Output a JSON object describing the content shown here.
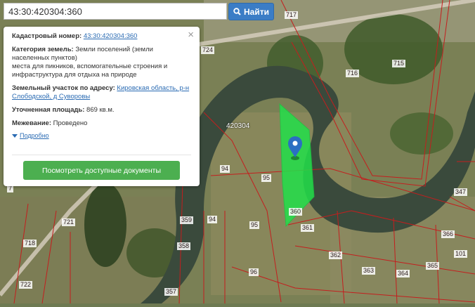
{
  "search": {
    "value": "43:30:420304:360",
    "button_label": "Найти"
  },
  "popup": {
    "cadastral_label": "Кадастровый номер:",
    "cadastral_value": "43:30:420304:360",
    "category_label": "Категория земель:",
    "category_value": "Земли поселений (земли населенных пунктов)",
    "purpose_text": "места для пикников, вспомогательные строения и инфраструктура для отдыха на природе",
    "address_label": "Земельный участок по адресу:",
    "address_value": "Кировская область, р-н Слободской, д Суворовы",
    "area_label": "Уточненная площадь:",
    "area_value": "869 кв.м.",
    "survey_label": "Межевание:",
    "survey_value": "Проведено",
    "more_label": "Подробно",
    "docs_button": "Посмотреть доступные документы",
    "close_symbol": "×"
  },
  "map": {
    "block_label": "420304",
    "parcel_labels": [
      "717",
      "715",
      "716",
      "724",
      "94",
      "95",
      "95",
      "359",
      "94",
      "358",
      "361",
      "362",
      "363",
      "364",
      "365",
      "366",
      "347",
      "101",
      "721",
      "718",
      "722",
      "96",
      "357",
      "360",
      "7"
    ],
    "highlight_color": "#22e04a",
    "boundary_color": "#c41e1e"
  }
}
